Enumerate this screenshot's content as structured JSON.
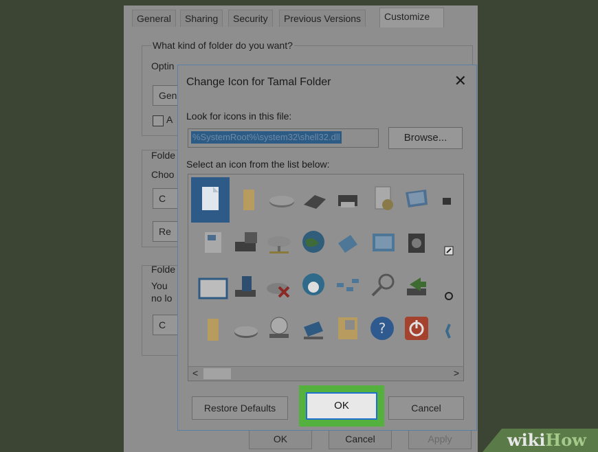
{
  "props_window": {
    "tabs": [
      "General",
      "Sharing",
      "Security",
      "Previous Versions",
      "Customize"
    ],
    "question": "What kind of folder do you want?",
    "optimize_partial": "Optin",
    "general_stub": "Gen",
    "checkbox_stub": "A",
    "folder_pictures_stub": "Folde",
    "choose_stub": "Choo",
    "choose_button_stub": "C",
    "restore_button_stub": "Re",
    "folder_icons_stub": "Folde",
    "you_stub": "You",
    "no_stub": "no lo",
    "change_stub": "C",
    "bottom_buttons": [
      "OK",
      "Cancel",
      "Apply"
    ]
  },
  "dialog": {
    "title": "Change Icon for Tamal Folder",
    "close_glyph": "✕",
    "look_label": "Look for icons in this file:",
    "path_value": "%SystemRoot%\\system32\\shell32.dll",
    "browse_label": "Browse...",
    "select_label": "Select an icon from the list below:",
    "scroll_left": "<",
    "scroll_right": ">",
    "restore_label": "Restore Defaults",
    "ok_label": "OK",
    "cancel_label": "Cancel"
  },
  "icons": [
    "blank-file-icon",
    "folder-icon",
    "drive-icon",
    "chip-icon",
    "printer-icon",
    "drive-icon",
    "document-clock-icon",
    "monitor-icon",
    "shortcut-icon",
    "document-image-icon",
    "printer-computer-icon",
    "network-drive-icon",
    "globe-icon",
    "network-computer-icon",
    "control-panel-icon",
    "speaker-icon",
    "shortcut-arrow-icon",
    "window-icon",
    "drive-install-icon",
    "drive-delete-icon",
    "cd-icon",
    "network-icon",
    "magnifier-icon",
    "drive-arrow-icon",
    "disc-icon",
    "folder-icon",
    "drive-icon",
    "cd-drive-icon",
    "computer-icon",
    "folder-icon",
    "help-icon",
    "power-icon",
    "ie-icon"
  ],
  "watermark": {
    "wiki": "wiki",
    "how": "How"
  },
  "colors": {
    "ok_highlight": "#55b13d",
    "ok_border": "#1d6fd0",
    "selection": "#2c5b85"
  }
}
